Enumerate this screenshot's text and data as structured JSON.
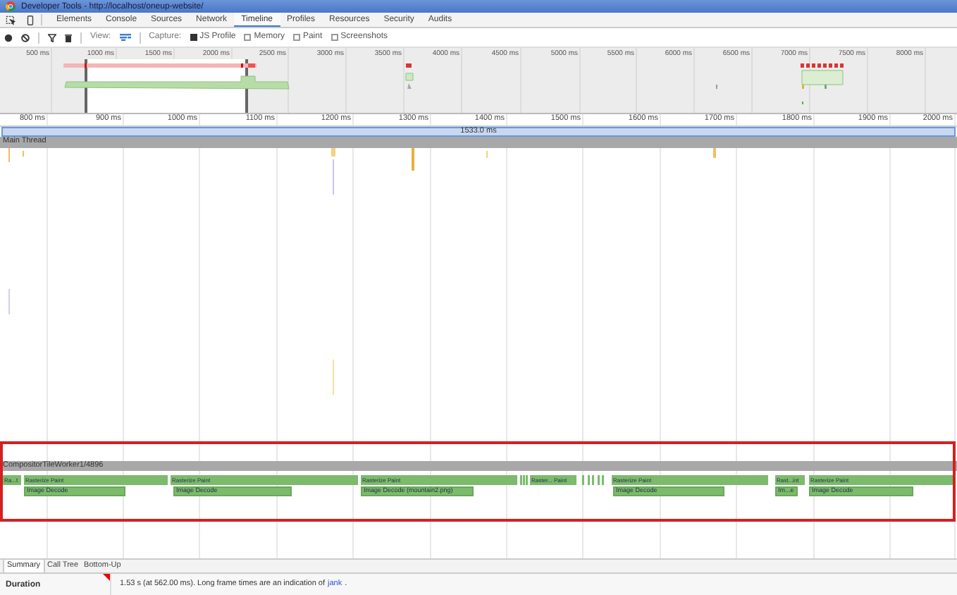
{
  "window": {
    "title": "Developer Tools - http://localhost/oneup-website/"
  },
  "tabs": [
    {
      "label": "Elements",
      "selected": false
    },
    {
      "label": "Console",
      "selected": false
    },
    {
      "label": "Sources",
      "selected": false
    },
    {
      "label": "Network",
      "selected": false
    },
    {
      "label": "Timeline",
      "selected": true
    },
    {
      "label": "Profiles",
      "selected": false
    },
    {
      "label": "Resources",
      "selected": false
    },
    {
      "label": "Security",
      "selected": false
    },
    {
      "label": "Audits",
      "selected": false
    }
  ],
  "toolbar": {
    "view_label": "View:",
    "capture_label": "Capture:",
    "capture_options": [
      {
        "label": "JS Profile",
        "checked": true
      },
      {
        "label": "Memory",
        "checked": false
      },
      {
        "label": "Paint",
        "checked": false
      },
      {
        "label": "Screenshots",
        "checked": false
      }
    ]
  },
  "overview": {
    "ticks": [
      "500 ms",
      "1000 ms",
      "1500 ms",
      "2000 ms",
      "2500 ms",
      "3000 ms",
      "3500 ms",
      "4000 ms",
      "4500 ms",
      "5000 ms",
      "5500 ms",
      "6000 ms",
      "6500 ms",
      "7000 ms",
      "7500 ms",
      "8000 ms"
    ]
  },
  "ruler": {
    "ticks": [
      "800 ms",
      "900 ms",
      "1000 ms",
      "1100 ms",
      "1200 ms",
      "1300 ms",
      "1400 ms",
      "1500 ms",
      "1600 ms",
      "1700 ms",
      "1800 ms",
      "1900 ms",
      "2000 ms"
    ]
  },
  "frame": {
    "duration": "1533.0 ms"
  },
  "main_thread": {
    "label": "Main Thread"
  },
  "compositor": {
    "label": "CompositorTileWorker1/4896",
    "row_1": [
      "Ra...t",
      "Rasterize Paint",
      "Rasterize Paint",
      "Rasterize Paint",
      "Raster... Paint",
      "Rasterize Paint",
      "Rast...int",
      "Rasterize Paint"
    ],
    "row_2": [
      "Image Decode",
      "Image Decode",
      "Image Decode (mountain2.png)",
      "Image Decode",
      "Im...e",
      "Image Decode"
    ]
  },
  "details": {
    "tabs": [
      {
        "label": "Summary",
        "selected": true
      },
      {
        "label": "Call Tree",
        "selected": false
      },
      {
        "label": "Bottom-Up",
        "selected": false
      }
    ],
    "duration_label": "Duration",
    "duration_text": "1.53 s (at 562.00 ms). Long frame times are an indication of",
    "link": "jank",
    "duration_end": "."
  }
}
